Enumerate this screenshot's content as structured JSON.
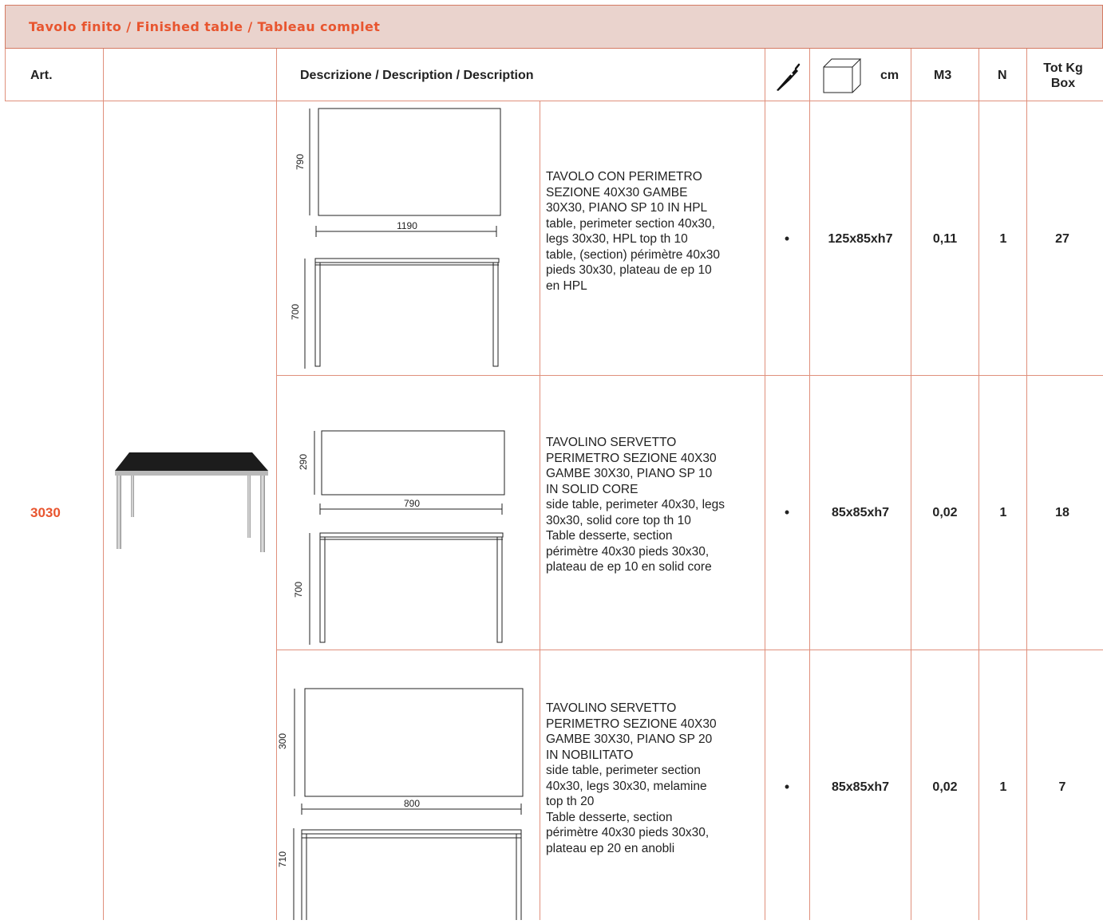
{
  "section": {
    "title": "Tavolo finito / Finished table / Tableau complet"
  },
  "columns": {
    "art": "Art.",
    "description": "Descrizione / Description / Description",
    "tool_icon": "screwdriver-icon",
    "box_icon": "box-icon",
    "cm": "cm",
    "m3": "M3",
    "n": "N",
    "tot_kg_line1": "Tot Kg",
    "tot_kg_line2": "Box"
  },
  "article": {
    "code": "3030"
  },
  "rows": [
    {
      "desc_lines": [
        "TAVOLO CON PERIMETRO",
        "SEZIONE 40X30 GAMBE",
        "30X30, PIANO SP 10 IN HPL",
        "table, perimeter section 40x30,",
        "legs 30x30, HPL top th 10",
        "table, (section) périmètre 40x30",
        "pieds 30x30, plateau de ep 10",
        "en HPL"
      ],
      "bullet": "•",
      "cm": "125x85xh7",
      "m3": "0,11",
      "n": "1",
      "kg": "27",
      "dim_depth": "790",
      "dim_width": "1190",
      "dim_height": "700"
    },
    {
      "desc_lines": [
        "TAVOLINO SERVETTO",
        "PERIMETRO SEZIONE 40X30",
        "GAMBE 30X30, PIANO SP 10",
        "IN SOLID CORE",
        "side table, perimeter 40x30, legs",
        "30x30, solid core top th 10",
        "Table desserte, section",
        "périmètre 40x30 pieds 30x30,",
        "plateau de ep 10 en solid core"
      ],
      "bullet": "•",
      "cm": "85x85xh7",
      "m3": "0,02",
      "n": "1",
      "kg": "18",
      "dim_depth": "290",
      "dim_width": "790",
      "dim_height": "700"
    },
    {
      "desc_lines": [
        "TAVOLINO SERVETTO",
        "PERIMETRO SEZIONE 40X30",
        "GAMBE 30X30, PIANO SP 20",
        "IN NOBILITATO",
        "side table, perimeter section",
        "40x30, legs 30x30, melamine",
        "top th 20",
        "Table desserte, section",
        "périmètre 40x30 pieds 30x30,",
        "plateau ep 20 en anobli"
      ],
      "bullet": "•",
      "cm": "85x85xh7",
      "m3": "0,02",
      "n": "1",
      "kg": "7",
      "dim_depth": "300",
      "dim_width": "800",
      "dim_height": "710"
    }
  ]
}
